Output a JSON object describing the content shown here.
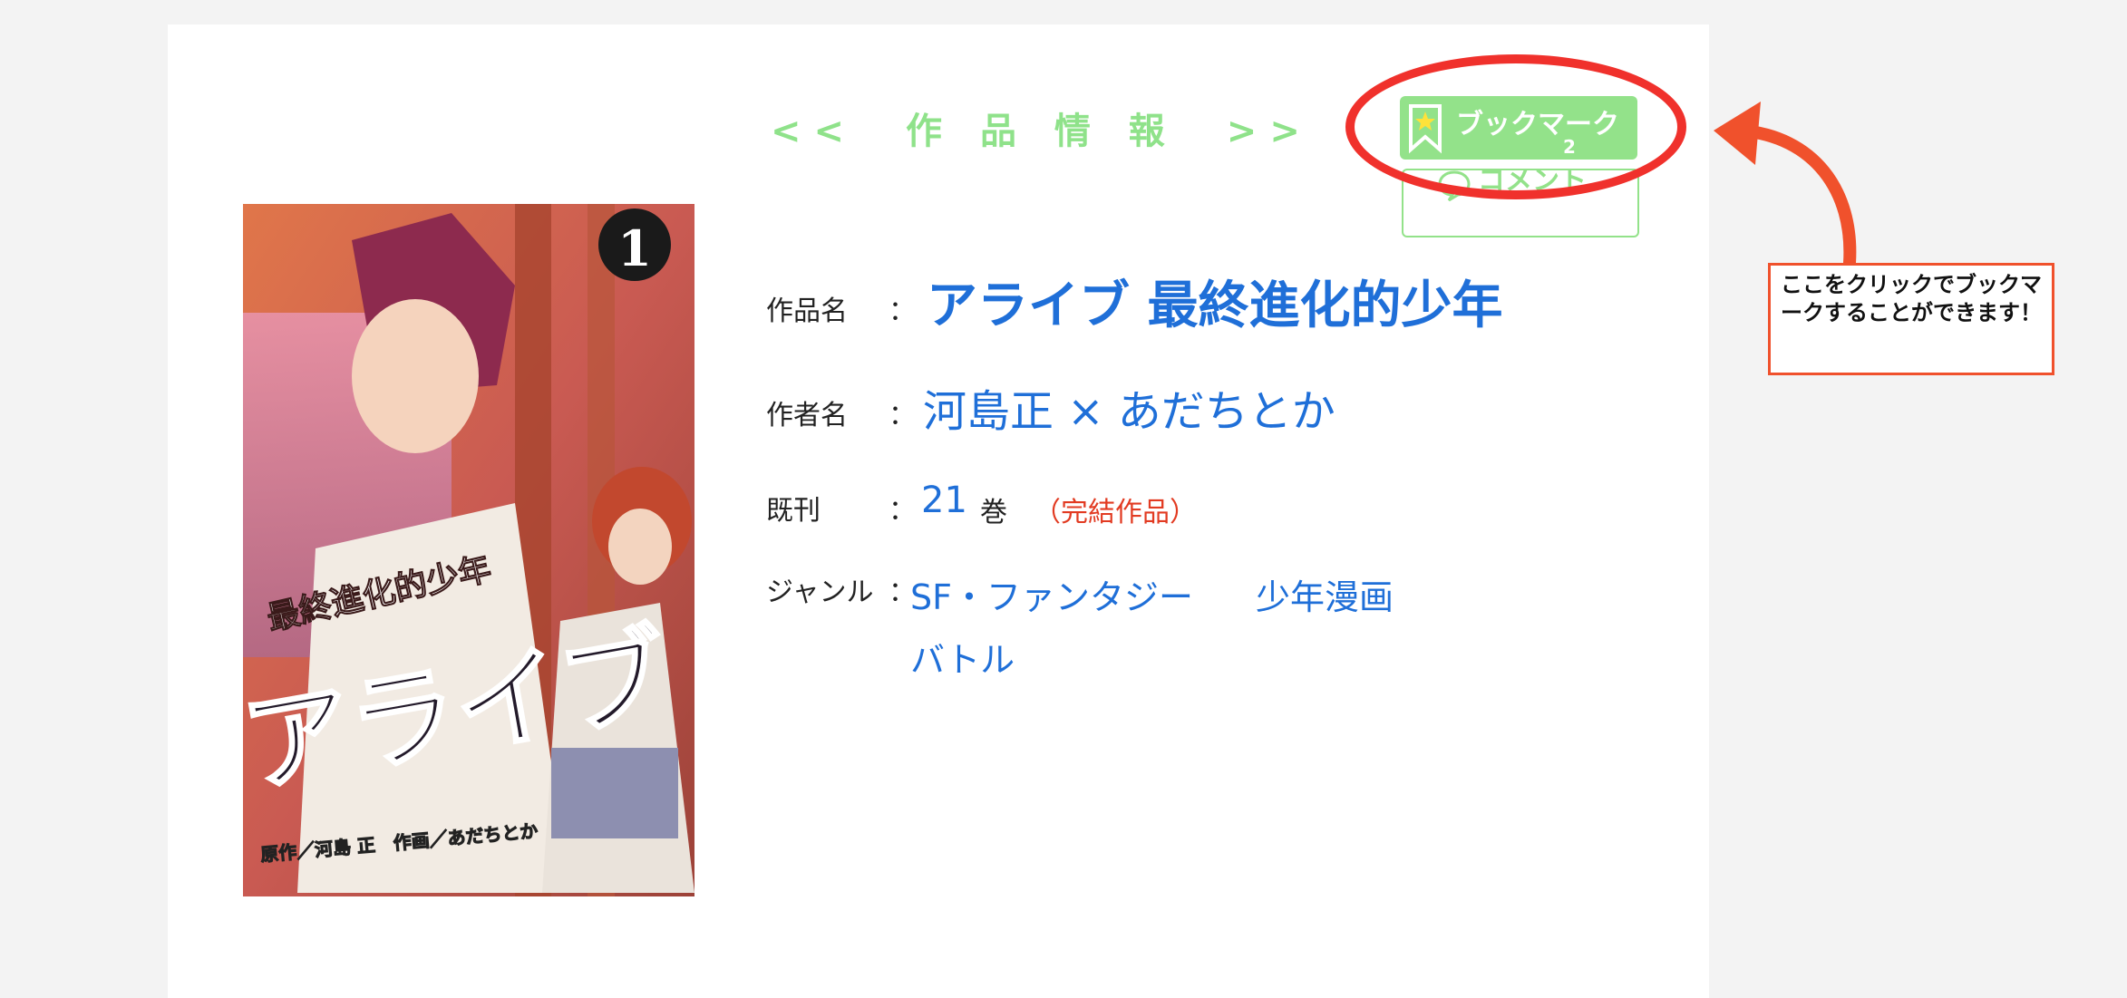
{
  "heading": "<<　作 品 情 報　>>",
  "buttons": {
    "bookmark_label": "ブックマーク",
    "bookmark_count": "2",
    "comment_label": "コメント"
  },
  "cover": {
    "volume_badge": "1",
    "subtitle": "最終進化的少年",
    "title": "アライブ",
    "credits": "原作／河島 正　作画／あだちとか"
  },
  "info": {
    "title_label": "作品名",
    "title_value": "アライブ 最終進化的少年",
    "author_label": "作者名",
    "author_value": "河島正 × あだちとか",
    "volumes_label": "既刊",
    "volumes_value": "21",
    "volumes_unit": "巻",
    "volumes_status": "（完結作品）",
    "genre_label": "ジャンル",
    "separator": "：",
    "genres": [
      "SF・ファンタジー",
      "少年漫画",
      "バトル"
    ]
  },
  "annotation": {
    "callout": "ここをクリックでブックマークすることができます！",
    "colors": {
      "ring": "#f0312c",
      "arrow": "#f0512c"
    }
  },
  "colors": {
    "accent_green": "#93e28a",
    "link_blue": "#1f6fd8",
    "status_red": "#e23b22"
  }
}
